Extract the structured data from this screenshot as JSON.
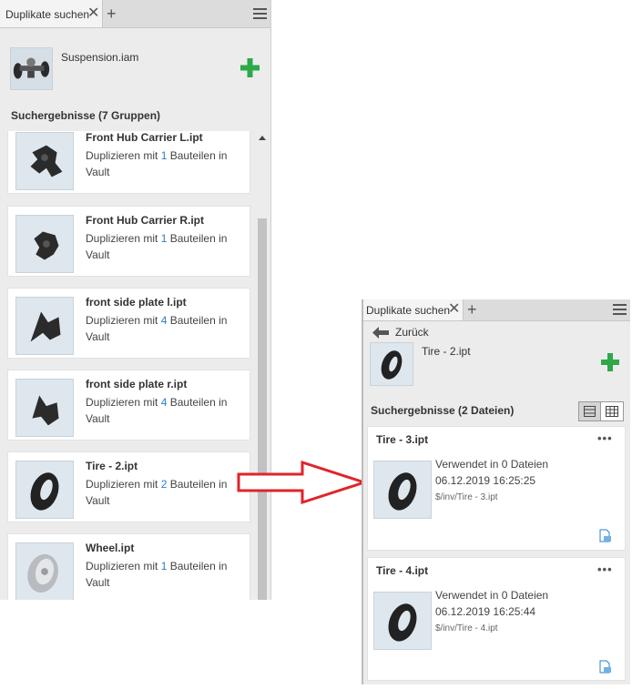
{
  "left_panel": {
    "tab_title": "Duplikate suchen",
    "assembly_name": "Suspension.iam",
    "section_title": "Suchergebnisse (7 Gruppen)",
    "results": [
      {
        "name": "Front Hub Carrier L.ipt",
        "prefix": "Duplizieren mit ",
        "count": "1",
        "suffix": " Bauteilen in",
        "line2": "Vault",
        "icon": "hub-carrier-thumbnail"
      },
      {
        "name": "Front Hub Carrier R.ipt",
        "prefix": "Duplizieren mit ",
        "count": "1",
        "suffix": " Bauteilen in",
        "line2": "Vault",
        "icon": "hub-carrier-thumbnail"
      },
      {
        "name": "front side plate l.ipt",
        "prefix": "Duplizieren mit ",
        "count": "4",
        "suffix": " Bauteilen in",
        "line2": "Vault",
        "icon": "side-plate-thumbnail"
      },
      {
        "name": "front side plate r.ipt",
        "prefix": "Duplizieren mit ",
        "count": "4",
        "suffix": " Bauteilen in",
        "line2": "Vault",
        "icon": "side-plate-thumbnail"
      },
      {
        "name": "Tire - 2.ipt",
        "prefix": "Duplizieren mit ",
        "count": "2",
        "suffix": " Bauteilen in",
        "line2": "Vault",
        "icon": "tire-thumbnail"
      },
      {
        "name": "Wheel.ipt",
        "prefix": "Duplizieren mit ",
        "count": "1",
        "suffix": " Bauteilen in",
        "line2": "Vault",
        "icon": "wheel-thumbnail"
      }
    ]
  },
  "right_panel": {
    "tab_title": "Duplikate suchen",
    "back_label": "Zurück",
    "part_name": "Tire - 2.ipt",
    "section_title": "Suchergebnisse (2 Dateien)",
    "files": [
      {
        "name": "Tire - 3.ipt",
        "used": "Verwendet in 0 Dateien",
        "date": "06.12.2019 16:25:25",
        "path": "$/inv/Tire - 3.ipt"
      },
      {
        "name": "Tire - 4.ipt",
        "used": "Verwendet in 0 Dateien",
        "date": "06.12.2019 16:25:44",
        "path": "$/inv/Tire - 4.ipt"
      }
    ]
  },
  "colors": {
    "accent_blue": "#2a7fc9",
    "plus_green": "#2ea84a",
    "arrow_red": "#e0242a",
    "panel_bg": "#ececec"
  }
}
